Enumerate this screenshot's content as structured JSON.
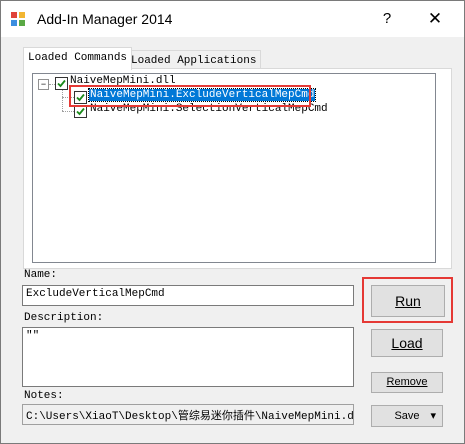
{
  "window": {
    "title": "Add-In Manager 2014",
    "help_glyph": "?",
    "close_glyph": "✕"
  },
  "tabs": [
    {
      "label": "Loaded Commands",
      "active": true
    },
    {
      "label": "Loaded Applications",
      "active": false
    }
  ],
  "tree": {
    "root": {
      "label": "NaiveMepMini.dll",
      "expanded": true,
      "checked": true
    },
    "children": [
      {
        "label": "NaiveMepMini.ExcludeVerticalMepCmd",
        "checked": true,
        "selected": true
      },
      {
        "label": "NaiveMepMini.SelectionVerticalMepCmd",
        "checked": true,
        "selected": false
      }
    ],
    "expander_glyph": "−"
  },
  "form": {
    "name_label": "Name:",
    "name_value": "ExcludeVerticalMepCmd",
    "description_label": "Description:",
    "description_value": "\"\"",
    "notes_label": "Notes:",
    "notes_value": "C:\\Users\\XiaoT\\Desktop\\管综易迷你插件\\NaiveMepMini.dll"
  },
  "buttons": {
    "run_label": "Run",
    "load_label": "Load",
    "remove_label": "Remove",
    "save_label": "Save",
    "save_dropdown_glyph": "▾"
  },
  "highlight_color": "#e53935"
}
